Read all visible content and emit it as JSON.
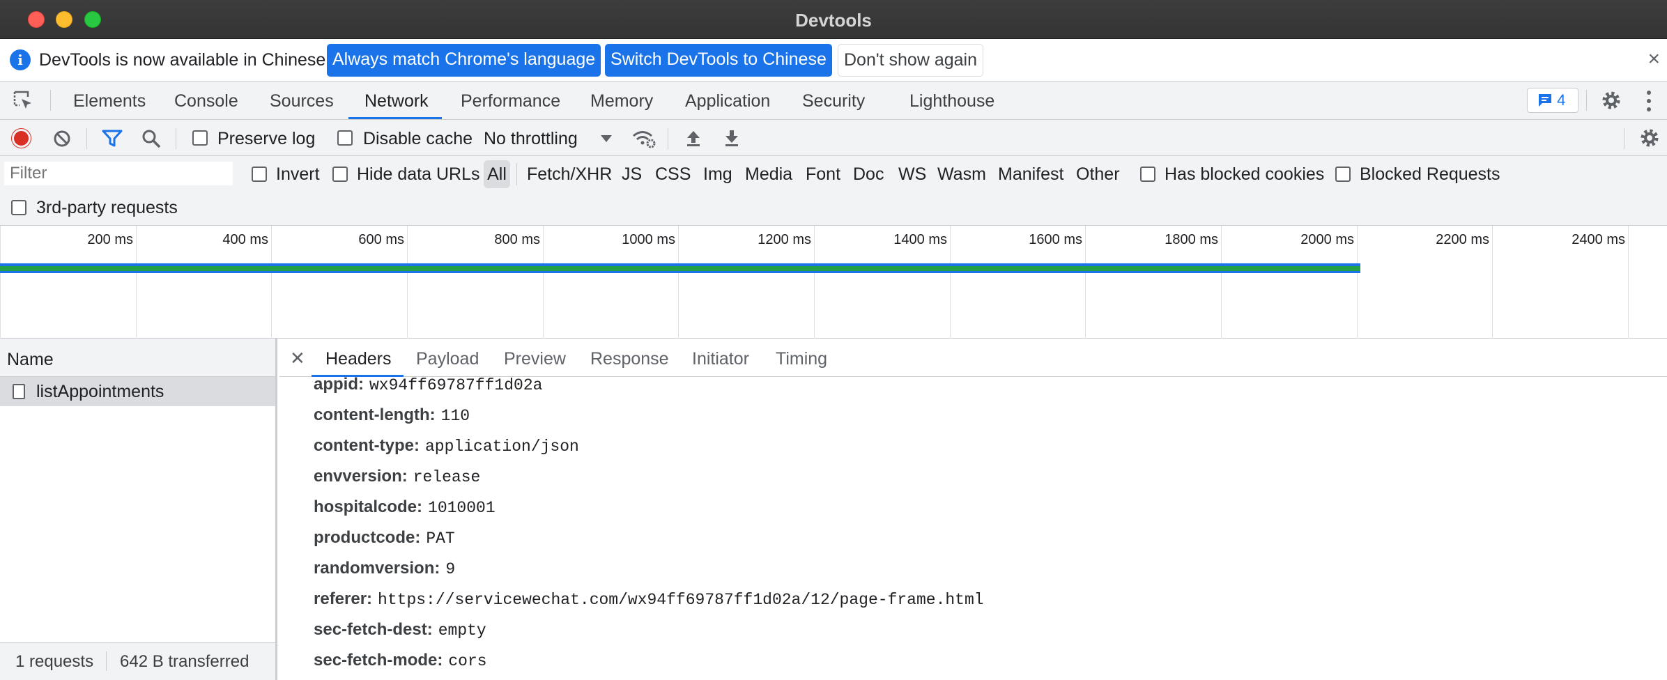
{
  "window": {
    "title": "Devtools"
  },
  "infobar": {
    "message": "DevTools is now available in Chinese!",
    "btn_match": "Always match Chrome's language",
    "btn_switch": "Switch DevTools to Chinese",
    "btn_dismiss": "Don't show again",
    "close": "×"
  },
  "tabs": [
    "Elements",
    "Console",
    "Sources",
    "Network",
    "Performance",
    "Memory",
    "Application",
    "Security",
    "Lighthouse"
  ],
  "active_tab": "Network",
  "issues_count": "4",
  "toolbar": {
    "preserve_log": "Preserve log",
    "disable_cache": "Disable cache",
    "throttling": "No throttling"
  },
  "filter": {
    "placeholder": "Filter",
    "invert": "Invert",
    "hide_data_urls": "Hide data URLs",
    "types": [
      "All",
      "Fetch/XHR",
      "JS",
      "CSS",
      "Img",
      "Media",
      "Font",
      "Doc",
      "WS",
      "Wasm",
      "Manifest",
      "Other"
    ],
    "has_blocked_cookies": "Has blocked cookies",
    "blocked_requests": "Blocked Requests",
    "third_party": "3rd-party requests"
  },
  "overview": {
    "ticks": [
      "200 ms",
      "400 ms",
      "600 ms",
      "800 ms",
      "1000 ms",
      "1200 ms",
      "1400 ms",
      "1600 ms",
      "1800 ms",
      "2000 ms",
      "2200 ms",
      "2400 ms"
    ]
  },
  "requests": {
    "column": "Name",
    "rows": [
      "listAppointments"
    ],
    "status_count": "1 requests",
    "status_transferred": "642 B transferred"
  },
  "detail": {
    "tabs": [
      "Headers",
      "Payload",
      "Preview",
      "Response",
      "Initiator",
      "Timing"
    ],
    "active_tab": "Headers",
    "headers": [
      {
        "name": "appid:",
        "value": "wx94ff69787ff1d02a"
      },
      {
        "name": "content-length:",
        "value": "110"
      },
      {
        "name": "content-type:",
        "value": "application/json"
      },
      {
        "name": "envversion:",
        "value": "release"
      },
      {
        "name": "hospitalcode:",
        "value": "1010001"
      },
      {
        "name": "productcode:",
        "value": "PAT"
      },
      {
        "name": "randomversion:",
        "value": "9"
      },
      {
        "name": "referer:",
        "value": "https://servicewechat.com/wx94ff69787ff1d02a/12/page-frame.html"
      },
      {
        "name": "sec-fetch-dest:",
        "value": "empty"
      },
      {
        "name": "sec-fetch-mode:",
        "value": "cors"
      }
    ]
  },
  "colors": {
    "accent": "#1a73e8",
    "record": "#d93025",
    "waterfall_green": "#22a14a"
  }
}
